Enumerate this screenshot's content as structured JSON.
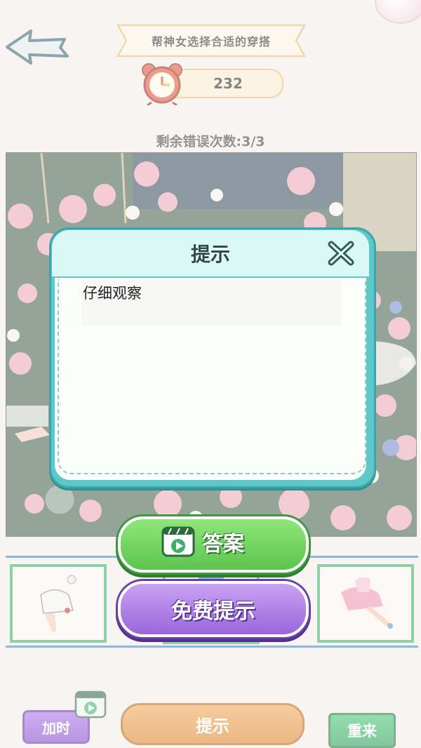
{
  "header": {
    "title": "帮神女选择合适的穿搭",
    "timer_value": "232",
    "mistakes_label": "剩余错误次数:3/3"
  },
  "dialog": {
    "title": "提示",
    "hint_text": "仔细观察"
  },
  "actions": {
    "answer_label": "答案",
    "free_hint_label": "免费提示"
  },
  "bottom_bar": {
    "add_time_label": "加时",
    "hint_label": "提示",
    "restart_label": "重来"
  },
  "colors": {
    "dialog_frame": "#5fc7c8",
    "answer_green": "#5cc44f",
    "free_hint_purple": "#9a66db",
    "hint_orange": "#d97d1f",
    "restart_green": "#1f9a4c",
    "add_time_purple": "#7d3fc8",
    "outfit_frame": "#2fae5e"
  },
  "icons": [
    "back-arrow-icon",
    "alarm-clock-icon",
    "close-icon",
    "video-icon"
  ]
}
